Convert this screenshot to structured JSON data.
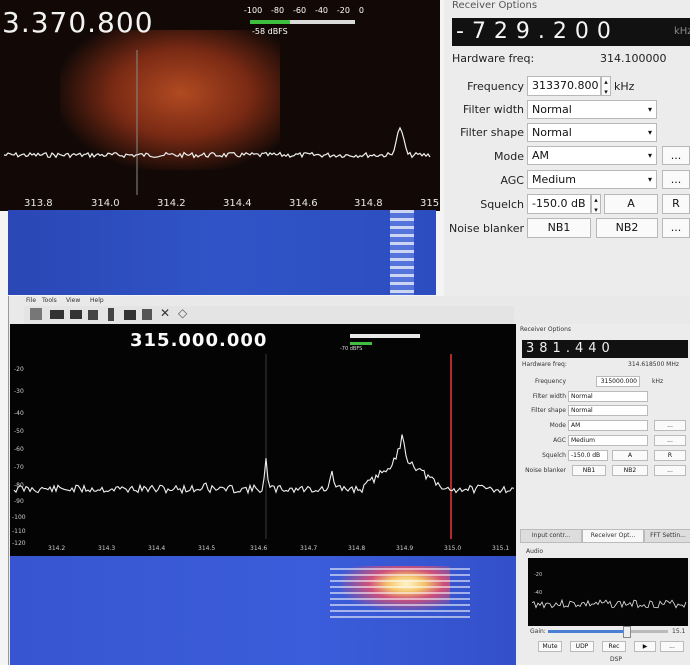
{
  "top": {
    "frequency": "3.370.800",
    "meter_scale": [
      "-100",
      "-80",
      "-60",
      "-40",
      "-20",
      "0"
    ],
    "meter_reading": "-58 dBFS",
    "x_ticks": [
      "313.8",
      "314.0",
      "314.2",
      "314.4",
      "314.6",
      "314.8",
      "315"
    ],
    "receiver_options": {
      "title": "Receiver Options",
      "lcd": "-729.200",
      "lcd_unit": "kHz",
      "hardware_freq_label": "Hardware freq:",
      "hardware_freq_value": "314.100000",
      "frequency_label": "Frequency",
      "frequency_value": "313370.800",
      "frequency_unit": "kHz",
      "filter_width_label": "Filter width",
      "filter_width_value": "Normal",
      "filter_shape_label": "Filter shape",
      "filter_shape_value": "Normal",
      "mode_label": "Mode",
      "mode_value": "AM",
      "agc_label": "AGC",
      "agc_value": "Medium",
      "squelch_label": "Squelch",
      "squelch_value": "-150.0 dB",
      "squelch_a": "A",
      "squelch_r": "R",
      "noise_blanker_label": "Noise blanker",
      "nb1": "NB1",
      "nb2": "NB2",
      "more_button": "..."
    }
  },
  "bottom": {
    "menu": [
      "File",
      "Tools",
      "View",
      "Help"
    ],
    "frequency": "315.000.000",
    "meter_reading": "-70 dBFS",
    "y_ticks": [
      "-20",
      "-30",
      "-40",
      "-50",
      "-60",
      "-70",
      "-80",
      "-90",
      "-100",
      "-110",
      "-120"
    ],
    "x_ticks": [
      "314.2",
      "314.3",
      "314.4",
      "314.5",
      "314.6",
      "314.7",
      "314.8",
      "314.9",
      "315.0",
      "315.1"
    ],
    "receiver_options": {
      "title": "Receiver Options",
      "lcd": "381.440",
      "hardware_freq_label": "Hardware freq:",
      "hardware_freq_value": "314.618500 MHz",
      "frequency_label": "Frequency",
      "frequency_value": "315000.000",
      "frequency_unit": "kHz",
      "filter_width_label": "Filter width",
      "filter_width_value": "Normal",
      "filter_shape_label": "Filter shape",
      "filter_shape_value": "Normal",
      "mode_label": "Mode",
      "mode_value": "AM",
      "agc_label": "AGC",
      "agc_value": "Medium",
      "squelch_label": "Squelch",
      "squelch_value": "-150.0 dB",
      "squelch_a": "A",
      "squelch_r": "R",
      "noise_blanker_label": "Noise blanker",
      "nb1": "NB1",
      "nb2": "NB2"
    },
    "tabs": [
      "Input contr...",
      "Receiver Opt...",
      "FFT Settin..."
    ],
    "audio": {
      "title": "Audio",
      "y_ticks": [
        "-20",
        "-40"
      ],
      "gain_label": "Gain:",
      "gain_value": "15.1",
      "gain_level": 0.65,
      "buttons": [
        "Mute",
        "UDP",
        "Rec"
      ],
      "dsp_label": "DSP"
    }
  }
}
